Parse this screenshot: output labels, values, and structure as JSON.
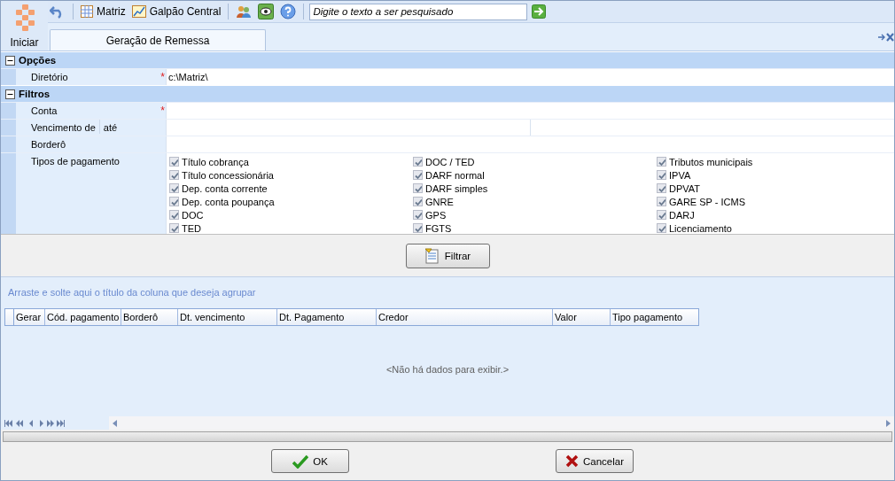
{
  "toolbar": {
    "items": [
      {
        "kind": "undo"
      },
      {
        "kind": "grid",
        "label": "Matriz"
      },
      {
        "kind": "chart",
        "label": "Galpão Central"
      },
      {
        "kind": "sep"
      },
      {
        "kind": "users"
      },
      {
        "kind": "eye"
      },
      {
        "kind": "help"
      }
    ],
    "search": {
      "placeholder": "Digite o texto a ser pesquisado"
    }
  },
  "start_button": {
    "label": "Iniciar"
  },
  "tabs": [
    {
      "label": "Geração de Remessa",
      "selected": true
    }
  ],
  "sections": [
    {
      "title": "Opções",
      "expanded": true,
      "rows": [
        {
          "kind": "text",
          "label": "Diretório",
          "marker": "*",
          "value": "c:\\Matriz\\"
        }
      ]
    },
    {
      "title": "Filtros",
      "expanded": true,
      "rows": [
        {
          "kind": "text",
          "label": "Conta",
          "marker": "*"
        },
        {
          "kind": "range",
          "label": "Vencimento de",
          "label_2": "até"
        },
        {
          "kind": "text",
          "label": "Borderô"
        },
        {
          "kind": "checks",
          "label": "Tipos de pagamento",
          "options": [
            {
              "label": "Título cobrança",
              "checked": true
            },
            {
              "label": "Título concessionária",
              "checked": true
            },
            {
              "label": "Dep. conta corrente",
              "checked": true
            },
            {
              "label": "Dep. conta poupança",
              "checked": true
            },
            {
              "label": "DOC",
              "checked": true
            },
            {
              "label": "TED",
              "checked": true
            },
            {
              "label": "DOC / TED",
              "checked": true
            },
            {
              "label": "DARF normal",
              "checked": true
            },
            {
              "label": "DARF simples",
              "checked": true
            },
            {
              "label": "GNRE",
              "checked": true
            },
            {
              "label": "GPS",
              "checked": true
            },
            {
              "label": "FGTS",
              "checked": true
            },
            {
              "label": "Tributos municipais",
              "checked": true
            },
            {
              "label": "IPVA",
              "checked": true
            },
            {
              "label": "DPVAT",
              "checked": true
            },
            {
              "label": "GARE SP - ICMS",
              "checked": true
            },
            {
              "label": "DARJ",
              "checked": true
            },
            {
              "label": "Licenciamento",
              "checked": true
            }
          ]
        }
      ]
    }
  ],
  "filter_button": {
    "label": "Filtrar"
  },
  "grid": {
    "group_hint": "Arraste e solte aqui o título da coluna que deseja agrupar",
    "columns": [
      "Gerar",
      "Cód. pagamento",
      "Borderô",
      "Dt. vencimento",
      "Dt. Pagamento",
      "Credor",
      "Valor",
      "Tipo pagamento"
    ],
    "empty_text": "<Não há dados para exibir.>"
  },
  "buttons": [
    {
      "kind": "ok",
      "label": "OK"
    },
    {
      "kind": "cancel",
      "label": "Cancelar"
    }
  ]
}
